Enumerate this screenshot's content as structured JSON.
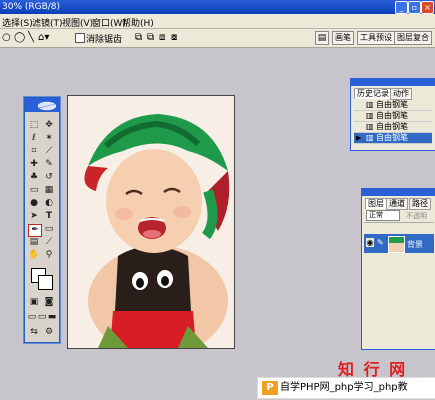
{
  "window": {
    "title": "30% (RGB/8)"
  },
  "menu": [
    "选择(S)",
    "滤镜(T)",
    "视图(V)",
    "窗口(W)",
    "帮助(H)"
  ],
  "options": {
    "antialias_label": "消除锯齿"
  },
  "right_tabs": [
    "画笔",
    "工具预设",
    "图层复合"
  ],
  "history_panel": {
    "tabs": [
      "历史记录",
      "动作"
    ],
    "items": [
      "自由钢笔",
      "自由钢笔",
      "自由钢笔",
      "自由钢笔"
    ],
    "selected_index": 3
  },
  "layers_panel": {
    "tabs": [
      "图层",
      "通道",
      "路径"
    ],
    "blend_mode": "正常",
    "opacity_label": "不透明",
    "layer_name": "背景"
  },
  "watermark": {
    "text": "知 行 网"
  },
  "footer": {
    "text": "自学PHP网_php学习_php教",
    "logo": "P"
  },
  "colors": {
    "titlebar": "#2a5fd8",
    "workspace": "#c8c4cc",
    "selection": "#316ac5",
    "watermark": "#e02020"
  }
}
